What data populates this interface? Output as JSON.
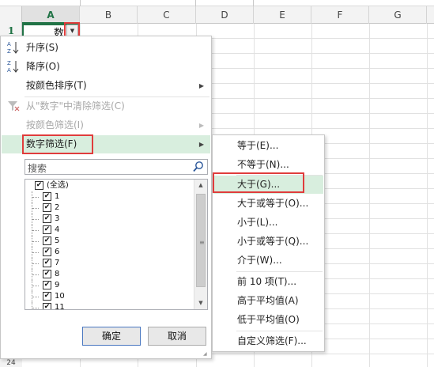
{
  "columns": [
    "A",
    "B",
    "C",
    "D",
    "E",
    "F",
    "G"
  ],
  "rows": [
    "1"
  ],
  "bottom_row": "24",
  "cell_a1": "数",
  "menu": {
    "sort_asc": "升序(S)",
    "sort_desc": "降序(O)",
    "sort_by_color": "按颜色排序(T)",
    "clear_filter": "从\"数字\"中清除筛选(C)",
    "filter_by_color": "按颜色筛选(I)",
    "number_filter": "数字筛选(F)"
  },
  "search": {
    "placeholder": "搜索"
  },
  "list": {
    "select_all": "(全选)",
    "items": [
      "1",
      "2",
      "3",
      "4",
      "5",
      "6",
      "7",
      "8",
      "9",
      "10",
      "11"
    ]
  },
  "buttons": {
    "ok": "确定",
    "cancel": "取消"
  },
  "submenu": {
    "equals": "等于(E)...",
    "not_equals": "不等于(N)...",
    "greater": "大于(G)...",
    "greater_equal": "大于或等于(O)...",
    "less": "小于(L)...",
    "less_equal": "小于或等于(Q)...",
    "between": "介于(W)...",
    "top10": "前 10 项(T)...",
    "above_avg": "高于平均值(A)",
    "below_avg": "低于平均值(O)",
    "custom": "自定义筛选(F)..."
  },
  "colors": {
    "accent": "#217346",
    "highlight": "#e03c3c",
    "hover": "#d8eede"
  }
}
